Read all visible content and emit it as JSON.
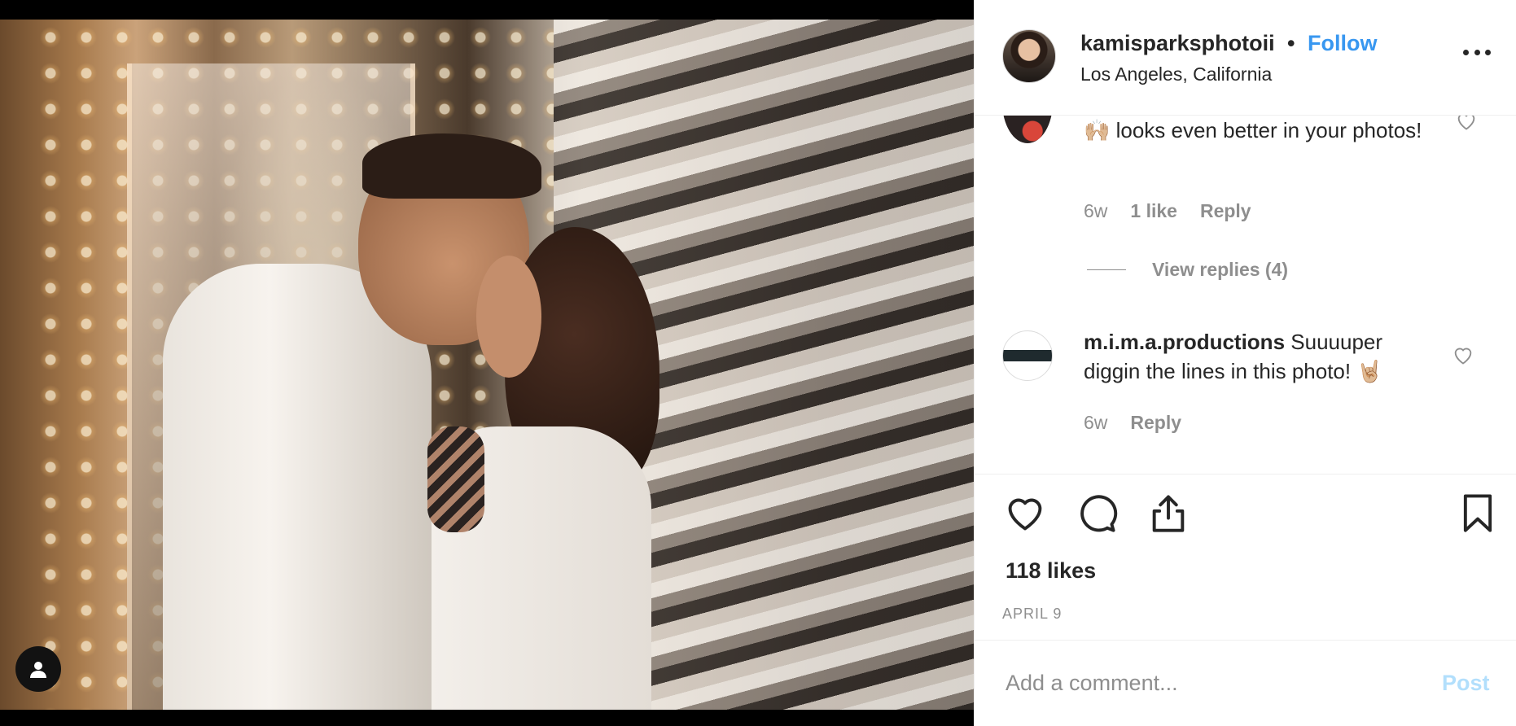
{
  "post": {
    "username": "kamisparksphotoii",
    "separator": "•",
    "follow_label": "Follow",
    "location": "Los Angeles, California"
  },
  "comments": [
    {
      "text": "🙌🏼 looks even better in your photos!",
      "age": "6w",
      "likes": "1 like",
      "reply_label": "Reply",
      "view_replies": "View replies (4)"
    },
    {
      "username": "m.i.m.a.productions",
      "text": "Suuuuper diggin the lines in this photo! 🤘🏼",
      "age": "6w",
      "reply_label": "Reply"
    }
  ],
  "likes": "118 likes",
  "date": "APRIL 9",
  "composer": {
    "placeholder": "Add a comment...",
    "post_label": "Post"
  },
  "colors": {
    "accent": "#3897f0",
    "text": "#262626",
    "muted": "#8e8e8e",
    "post_disabled": "#b2dffc",
    "divider": "#efefef"
  },
  "icons": [
    "user-tag-icon",
    "more-options-icon",
    "like-heart-icon",
    "comment-icon",
    "share-icon",
    "save-bookmark-icon",
    "comment-like-icon"
  ]
}
